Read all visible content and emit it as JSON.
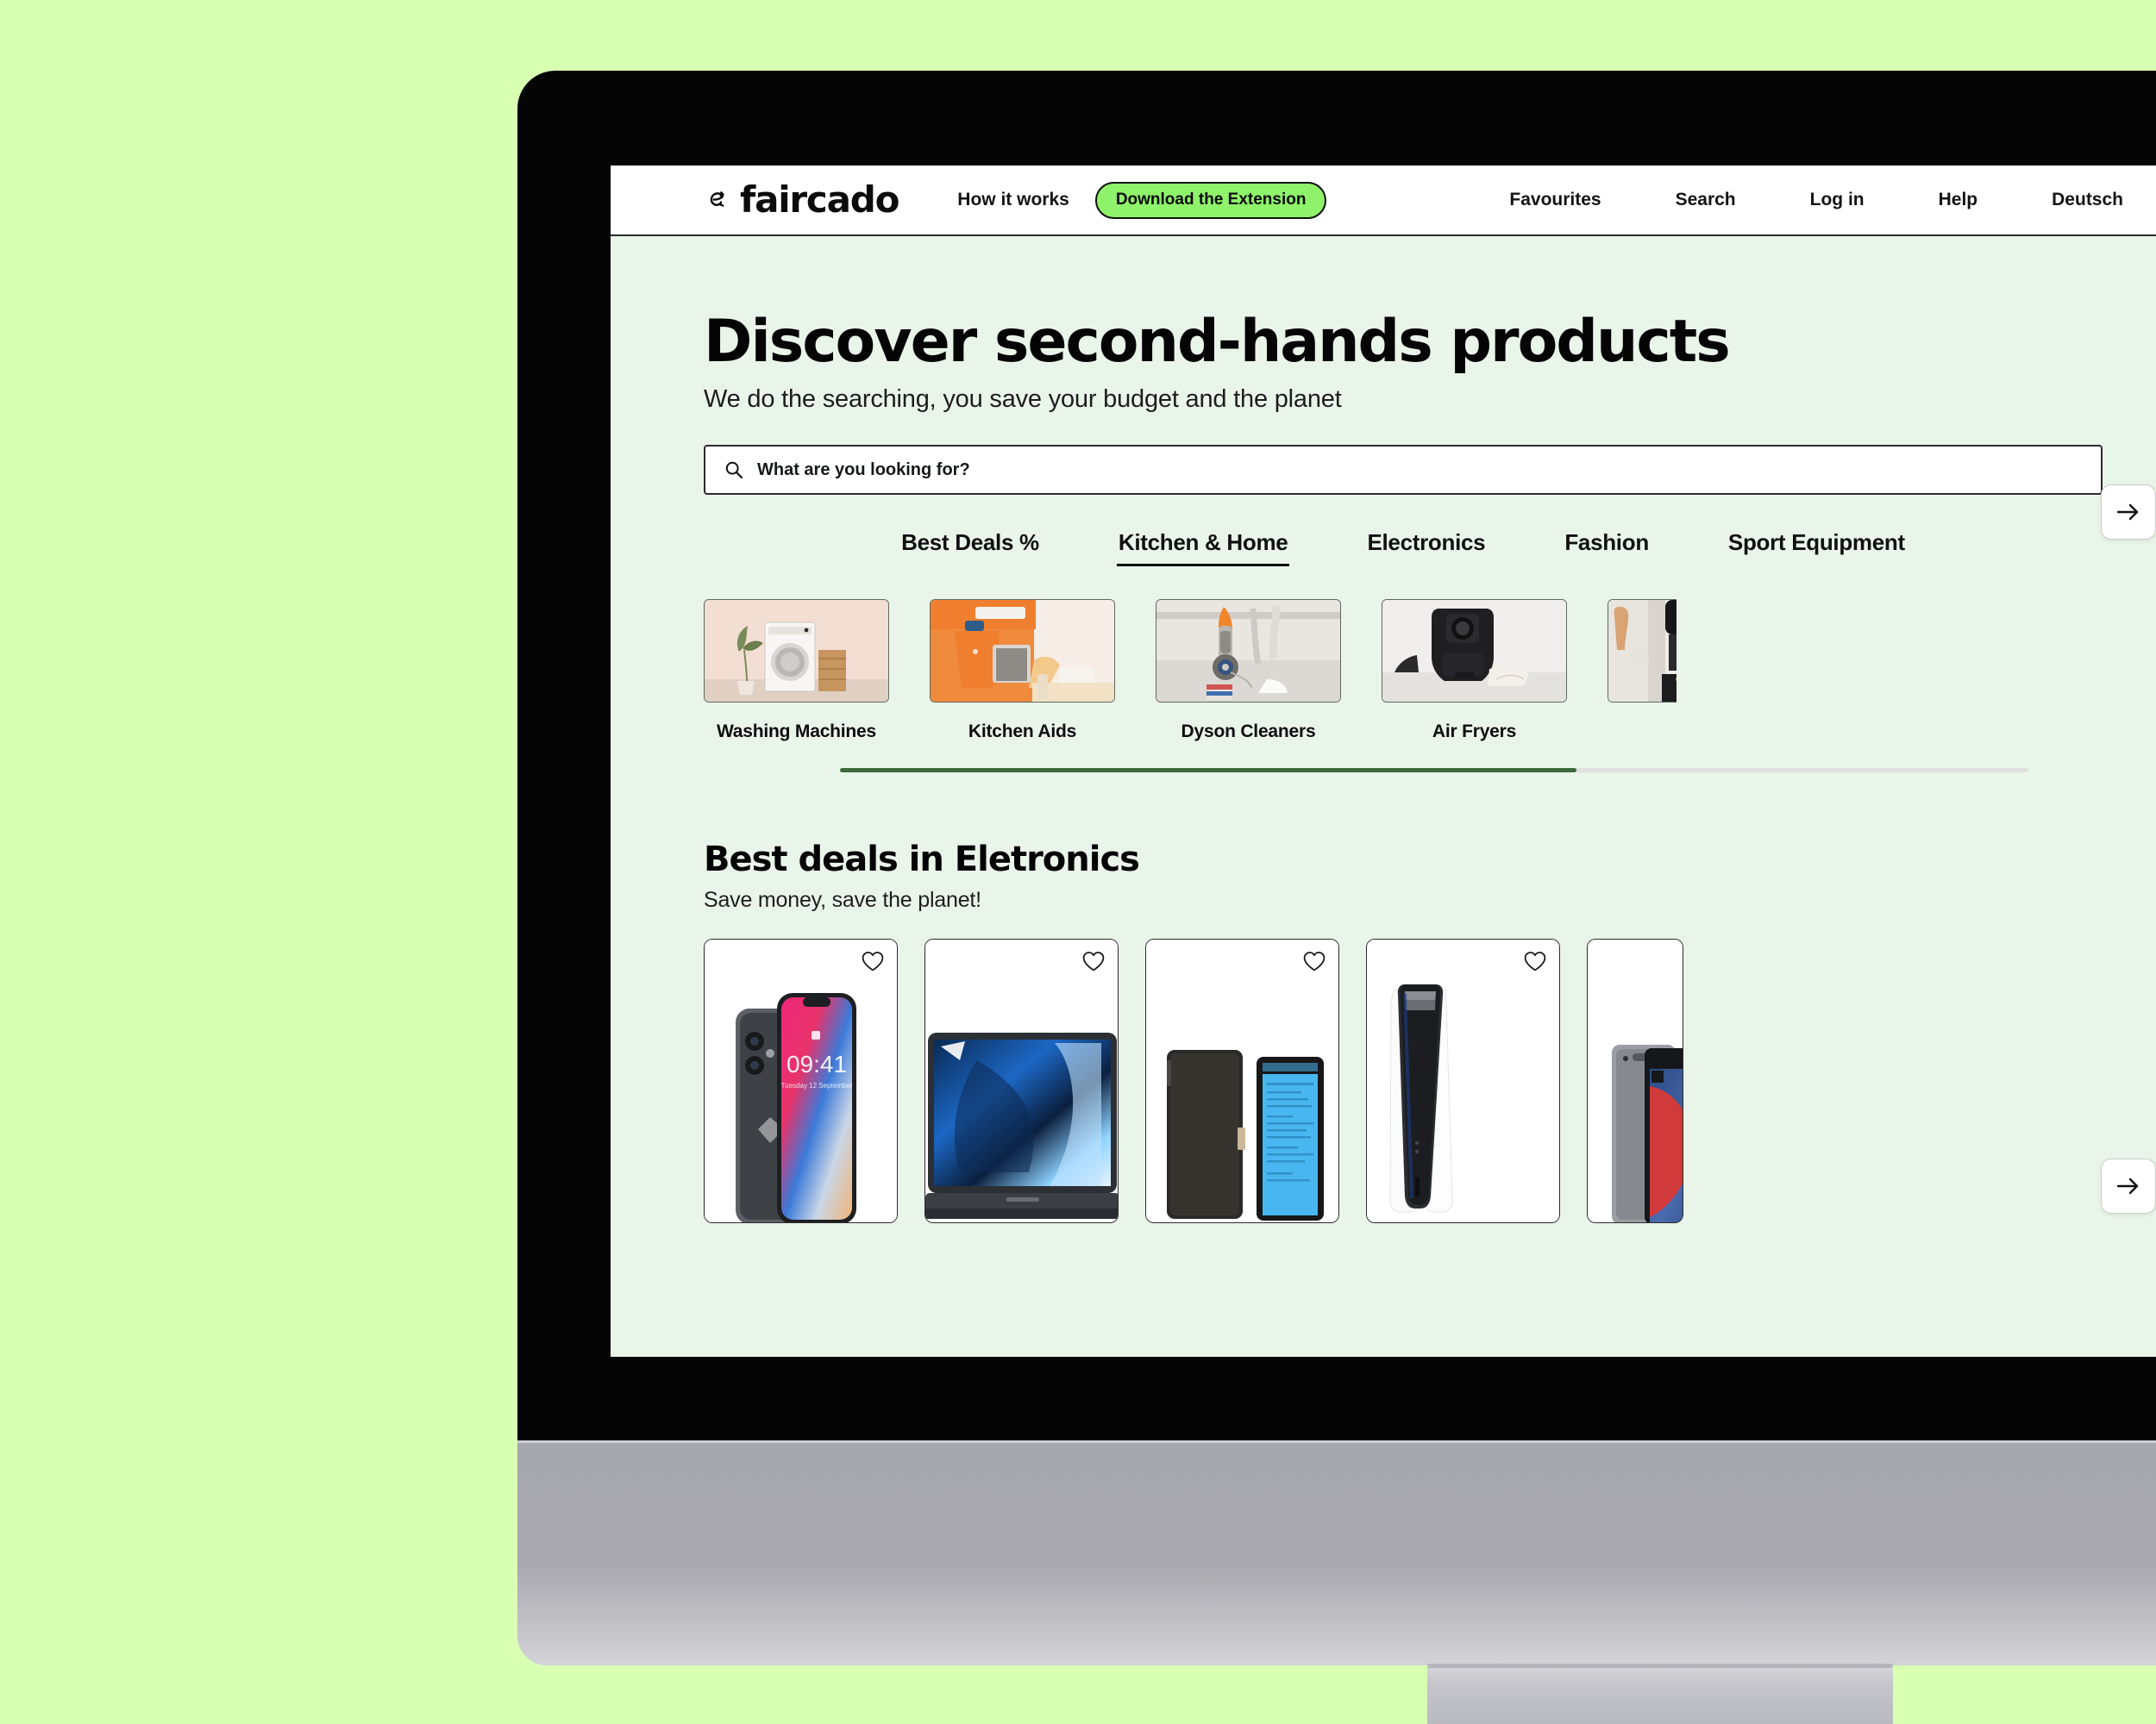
{
  "colors": {
    "outer_bg": "#d9ffb3",
    "page_bg": "#eaf5ea",
    "accent_green": "#8ef26a",
    "scroll_fill": "#3c6b3c",
    "ink": "#0a0a0a"
  },
  "navbar": {
    "brand": "faircado",
    "brand_icon": "recycle-e-icon",
    "how_it_works": "How it works",
    "extension_button": "Download the Extension",
    "links": [
      "Favourites",
      "Search",
      "Log in",
      "Help",
      "Deutsch"
    ]
  },
  "hero": {
    "title": "Discover second-hands products",
    "subtitle": "We do the searching, you save your budget and the planet"
  },
  "search": {
    "placeholder": "What are you looking for?",
    "value": "",
    "icon": "search-icon"
  },
  "tabs": [
    {
      "label": "Best Deals %",
      "active": false
    },
    {
      "label": "Kitchen & Home",
      "active": true
    },
    {
      "label": "Electronics",
      "active": false
    },
    {
      "label": "Fashion",
      "active": false
    },
    {
      "label": "Sport Equipment",
      "active": false
    }
  ],
  "categories": [
    {
      "label": "Washing Machines",
      "image": "washing-machine-photo"
    },
    {
      "label": "Kitchen Aids",
      "image": "stand-mixer-photo"
    },
    {
      "label": "Dyson Cleaners",
      "image": "vacuum-cleaner-photo"
    },
    {
      "label": "Air Fryers",
      "image": "air-fryer-photo"
    },
    {
      "label": "",
      "image": "coffee-machine-photo"
    }
  ],
  "carousel": {
    "next_label": "→",
    "scroll_position_percent": 62
  },
  "deals": {
    "title": "Best deals in Eletronics",
    "subtitle": "Save money, save the planet!",
    "next_label": "→",
    "products": [
      {
        "image": "iphone-x-photo",
        "favourite_icon": "heart-icon"
      },
      {
        "image": "dell-laptop-photo",
        "favourite_icon": "heart-icon"
      },
      {
        "image": "ereader-tablet-photo",
        "favourite_icon": "heart-icon"
      },
      {
        "image": "playstation-5-photo",
        "favourite_icon": "heart-icon"
      },
      {
        "image": "ipad-tablet-photo",
        "favourite_icon": "heart-icon"
      }
    ]
  }
}
